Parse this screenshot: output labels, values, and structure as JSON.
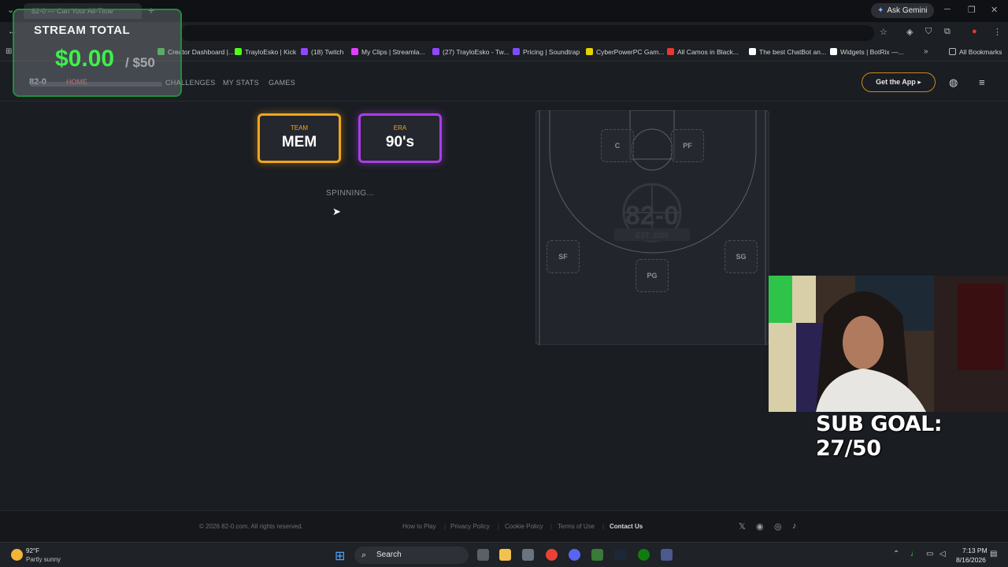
{
  "browser": {
    "tab_title": "82-0 — Can Your All-Time",
    "ask_gemini": "Ask Gemini",
    "bookmarks": [
      {
        "label": "Creator Dashboard |...",
        "color": "#3cb043"
      },
      {
        "label": "TrayloEsko | Kick",
        "color": "#53fc18"
      },
      {
        "label": "(18) Twitch",
        "color": "#9146ff"
      },
      {
        "label": "My Clips | Streamla...",
        "color": "#e040fb"
      },
      {
        "label": "(27) TrayloEsko - Tw...",
        "color": "#9146ff"
      },
      {
        "label": "Pricing | Soundtrap",
        "color": "#7c4dff"
      },
      {
        "label": "CyberPowerPC Gam...",
        "color": "#e6d400"
      },
      {
        "label": "All Camos in Black...",
        "color": "#e53935"
      },
      {
        "label": "The best ChatBot an...",
        "color": "#ffffff"
      },
      {
        "label": "Widgets | BotRix —...",
        "color": "#ffffff"
      }
    ],
    "all_bookmarks": "All Bookmarks"
  },
  "site": {
    "logo": "82-0",
    "nav": {
      "home": "HOME",
      "challenges": "CHALLENGES",
      "my_stats": "MY STATS",
      "games": "GAMES"
    },
    "get_app": "Get the App"
  },
  "spin": {
    "team_label": "TEAM",
    "team_value": "MEM",
    "era_label": "ERA",
    "era_value": "90's",
    "status": "SPINNING..."
  },
  "court": {
    "positions": [
      "C",
      "PF",
      "SF",
      "PG",
      "SG"
    ],
    "watermark": "82-0",
    "watermark_sub": "EST. 2025"
  },
  "footer": {
    "copyright": "© 2026 82-0.com. All rights reserved.",
    "links": [
      "How to Play",
      "Privacy Policy",
      "Cookie Policy",
      "Terms of Use"
    ],
    "contact": "Contact Us"
  },
  "taskbar": {
    "temp": "92°F",
    "weather": "Partly sunny",
    "search": "Search",
    "time": "7:13 PM",
    "date": "8/16/2026"
  },
  "overlay": {
    "stream_total_title": "STREAM TOTAL",
    "stream_total_amount": "$0.00",
    "stream_total_goal": "/ $50",
    "sub_goal": "SUB GOAL: 27/50"
  }
}
